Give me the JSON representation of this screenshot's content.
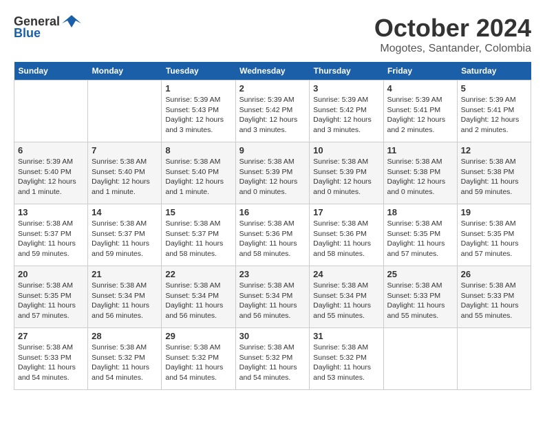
{
  "header": {
    "logo_general": "General",
    "logo_blue": "Blue",
    "month": "October 2024",
    "location": "Mogotes, Santander, Colombia"
  },
  "days_of_week": [
    "Sunday",
    "Monday",
    "Tuesday",
    "Wednesday",
    "Thursday",
    "Friday",
    "Saturday"
  ],
  "weeks": [
    [
      {
        "day": "",
        "info": ""
      },
      {
        "day": "",
        "info": ""
      },
      {
        "day": "1",
        "info": "Sunrise: 5:39 AM\nSunset: 5:43 PM\nDaylight: 12 hours and 3 minutes."
      },
      {
        "day": "2",
        "info": "Sunrise: 5:39 AM\nSunset: 5:42 PM\nDaylight: 12 hours and 3 minutes."
      },
      {
        "day": "3",
        "info": "Sunrise: 5:39 AM\nSunset: 5:42 PM\nDaylight: 12 hours and 3 minutes."
      },
      {
        "day": "4",
        "info": "Sunrise: 5:39 AM\nSunset: 5:41 PM\nDaylight: 12 hours and 2 minutes."
      },
      {
        "day": "5",
        "info": "Sunrise: 5:39 AM\nSunset: 5:41 PM\nDaylight: 12 hours and 2 minutes."
      }
    ],
    [
      {
        "day": "6",
        "info": "Sunrise: 5:39 AM\nSunset: 5:40 PM\nDaylight: 12 hours and 1 minute."
      },
      {
        "day": "7",
        "info": "Sunrise: 5:38 AM\nSunset: 5:40 PM\nDaylight: 12 hours and 1 minute."
      },
      {
        "day": "8",
        "info": "Sunrise: 5:38 AM\nSunset: 5:40 PM\nDaylight: 12 hours and 1 minute."
      },
      {
        "day": "9",
        "info": "Sunrise: 5:38 AM\nSunset: 5:39 PM\nDaylight: 12 hours and 0 minutes."
      },
      {
        "day": "10",
        "info": "Sunrise: 5:38 AM\nSunset: 5:39 PM\nDaylight: 12 hours and 0 minutes."
      },
      {
        "day": "11",
        "info": "Sunrise: 5:38 AM\nSunset: 5:38 PM\nDaylight: 12 hours and 0 minutes."
      },
      {
        "day": "12",
        "info": "Sunrise: 5:38 AM\nSunset: 5:38 PM\nDaylight: 11 hours and 59 minutes."
      }
    ],
    [
      {
        "day": "13",
        "info": "Sunrise: 5:38 AM\nSunset: 5:37 PM\nDaylight: 11 hours and 59 minutes."
      },
      {
        "day": "14",
        "info": "Sunrise: 5:38 AM\nSunset: 5:37 PM\nDaylight: 11 hours and 59 minutes."
      },
      {
        "day": "15",
        "info": "Sunrise: 5:38 AM\nSunset: 5:37 PM\nDaylight: 11 hours and 58 minutes."
      },
      {
        "day": "16",
        "info": "Sunrise: 5:38 AM\nSunset: 5:36 PM\nDaylight: 11 hours and 58 minutes."
      },
      {
        "day": "17",
        "info": "Sunrise: 5:38 AM\nSunset: 5:36 PM\nDaylight: 11 hours and 58 minutes."
      },
      {
        "day": "18",
        "info": "Sunrise: 5:38 AM\nSunset: 5:35 PM\nDaylight: 11 hours and 57 minutes."
      },
      {
        "day": "19",
        "info": "Sunrise: 5:38 AM\nSunset: 5:35 PM\nDaylight: 11 hours and 57 minutes."
      }
    ],
    [
      {
        "day": "20",
        "info": "Sunrise: 5:38 AM\nSunset: 5:35 PM\nDaylight: 11 hours and 57 minutes."
      },
      {
        "day": "21",
        "info": "Sunrise: 5:38 AM\nSunset: 5:34 PM\nDaylight: 11 hours and 56 minutes."
      },
      {
        "day": "22",
        "info": "Sunrise: 5:38 AM\nSunset: 5:34 PM\nDaylight: 11 hours and 56 minutes."
      },
      {
        "day": "23",
        "info": "Sunrise: 5:38 AM\nSunset: 5:34 PM\nDaylight: 11 hours and 56 minutes."
      },
      {
        "day": "24",
        "info": "Sunrise: 5:38 AM\nSunset: 5:34 PM\nDaylight: 11 hours and 55 minutes."
      },
      {
        "day": "25",
        "info": "Sunrise: 5:38 AM\nSunset: 5:33 PM\nDaylight: 11 hours and 55 minutes."
      },
      {
        "day": "26",
        "info": "Sunrise: 5:38 AM\nSunset: 5:33 PM\nDaylight: 11 hours and 55 minutes."
      }
    ],
    [
      {
        "day": "27",
        "info": "Sunrise: 5:38 AM\nSunset: 5:33 PM\nDaylight: 11 hours and 54 minutes."
      },
      {
        "day": "28",
        "info": "Sunrise: 5:38 AM\nSunset: 5:32 PM\nDaylight: 11 hours and 54 minutes."
      },
      {
        "day": "29",
        "info": "Sunrise: 5:38 AM\nSunset: 5:32 PM\nDaylight: 11 hours and 54 minutes."
      },
      {
        "day": "30",
        "info": "Sunrise: 5:38 AM\nSunset: 5:32 PM\nDaylight: 11 hours and 54 minutes."
      },
      {
        "day": "31",
        "info": "Sunrise: 5:38 AM\nSunset: 5:32 PM\nDaylight: 11 hours and 53 minutes."
      },
      {
        "day": "",
        "info": ""
      },
      {
        "day": "",
        "info": ""
      }
    ]
  ]
}
